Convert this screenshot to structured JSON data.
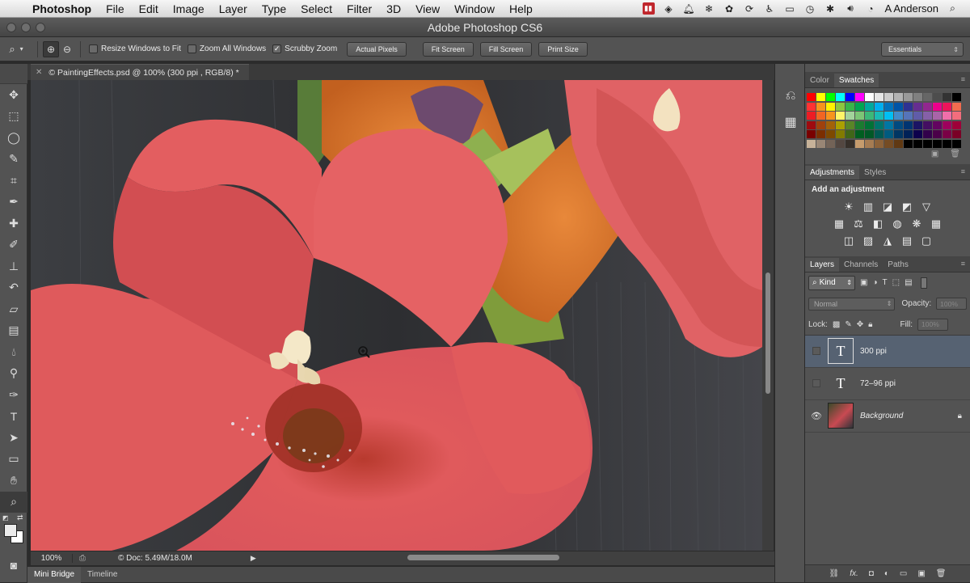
{
  "menubar": {
    "app_name": "Photoshop",
    "items": [
      "File",
      "Edit",
      "Image",
      "Layer",
      "Type",
      "Select",
      "Filter",
      "3D",
      "View",
      "Window",
      "Help"
    ],
    "user": "A Anderson"
  },
  "window": {
    "title": "Adobe Photoshop CS6"
  },
  "options_bar": {
    "resize_windows": "Resize Windows to Fit",
    "zoom_all_windows": "Zoom All Windows",
    "scrubby_zoom": "Scrubby Zoom",
    "actual_pixels": "Actual Pixels",
    "fit_screen": "Fit Screen",
    "fill_screen": "Fill Screen",
    "print_size": "Print Size",
    "workspace": "Essentials"
  },
  "document": {
    "tab_label": "© PaintingEffects.psd @ 100% (300 ppi , RGB/8) *",
    "zoom": "100%",
    "doc_info": "© Doc: 5.49M/18.0M"
  },
  "bottom_tabs": [
    "Mini Bridge",
    "Timeline"
  ],
  "color_panel": {
    "tabs": [
      "Color",
      "Swatches"
    ],
    "swatch_rows": [
      [
        "#ff0000",
        "#ffff00",
        "#00ff00",
        "#00ffff",
        "#0000ff",
        "#ff00ff",
        "#ffffff",
        "#e6e6e6",
        "#cccccc",
        "#b3b3b3",
        "#999999",
        "#808080",
        "#666666",
        "#4d4d4d",
        "#333333",
        "#000000"
      ],
      [
        "#ff3333",
        "#f7941d",
        "#fff200",
        "#8dc63f",
        "#39b54a",
        "#00a651",
        "#00a99d",
        "#00aeef",
        "#0072bc",
        "#0054a6",
        "#2e3192",
        "#662d91",
        "#92278f",
        "#ec008c",
        "#ed145b",
        "#f26c4f"
      ],
      [
        "#ed1c24",
        "#f26522",
        "#f7941d",
        "#fff568",
        "#a3d39c",
        "#7cc576",
        "#3cb878",
        "#1abbb4",
        "#00bff3",
        "#448ccb",
        "#5674b9",
        "#605ca8",
        "#8560a8",
        "#a864a8",
        "#f06eaa",
        "#f26d7d"
      ],
      [
        "#9e0b0f",
        "#a0410d",
        "#a36209",
        "#aba000",
        "#598527",
        "#1a7b30",
        "#007236",
        "#00746b",
        "#0076a3",
        "#004a80",
        "#003471",
        "#1b1464",
        "#440e62",
        "#630460",
        "#9e005d",
        "#9e0039"
      ],
      [
        "#790000",
        "#7b2e00",
        "#7d4900",
        "#827b00",
        "#406618",
        "#005e20",
        "#005826",
        "#005952",
        "#005b7f",
        "#003663",
        "#002157",
        "#0d004c",
        "#32004b",
        "#4b0049",
        "#7b0046",
        "#7a0026"
      ],
      [
        "#c7b299",
        "#998675",
        "#736357",
        "#534741",
        "#37302a",
        "#c69c6d",
        "#a67c52",
        "#8c6239",
        "#754c24",
        "#603913",
        "#000000",
        "#000000",
        "#000000",
        "#000000",
        "#000000",
        "#000000"
      ]
    ]
  },
  "adjustments_panel": {
    "tabs": [
      "Adjustments",
      "Styles"
    ],
    "title": "Add an adjustment"
  },
  "layers_panel": {
    "tabs": [
      "Layers",
      "Channels",
      "Paths"
    ],
    "kind": "Kind",
    "blend_mode": "Normal",
    "opacity_label": "Opacity:",
    "opacity_value": "100%",
    "lock_label": "Lock:",
    "fill_label": "Fill:",
    "fill_value": "100%",
    "layers": [
      {
        "name": "300 ppi",
        "type": "text",
        "selected": true,
        "visible": false
      },
      {
        "name": "72–96 ppi",
        "type": "text",
        "selected": false,
        "visible": false
      },
      {
        "name": "Background",
        "type": "image",
        "selected": false,
        "visible": true,
        "locked": true
      }
    ]
  }
}
